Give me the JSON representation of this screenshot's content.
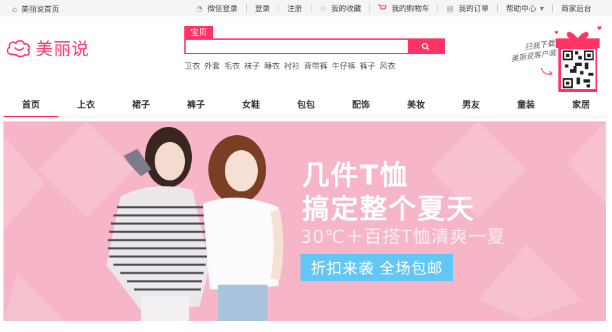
{
  "topbar": {
    "home": "美丽说首页",
    "links": {
      "wechat_login": "微信登录",
      "login": "登录",
      "register": "注册",
      "favorites": "我的收藏",
      "cart": "我的购物车",
      "orders": "我的订单",
      "help": "帮助中心",
      "merchant": "商家后台"
    }
  },
  "logo": {
    "text": "美丽说"
  },
  "search": {
    "tab": "宝贝",
    "value": "",
    "hotwords": [
      "卫衣",
      "外套",
      "毛衣",
      "袜子",
      "睡衣",
      "衬衫",
      "背带裤",
      "牛仔裤",
      "裤子",
      "风衣"
    ]
  },
  "qr": {
    "line1": "扫我下载",
    "line2": "美丽说客户端"
  },
  "nav": [
    "首页",
    "上衣",
    "裙子",
    "裤子",
    "女鞋",
    "包包",
    "配饰",
    "美妆",
    "男友",
    "童装",
    "家居"
  ],
  "banner": {
    "title1": "几件T恤",
    "title2": "搞定整个夏天",
    "subtitle": "30℃＋百搭T恤清爽一夏",
    "button": "折扣来袭 全场包邮"
  },
  "colors": {
    "brand": "#ff3366",
    "banner_bg": "#f6b6c8",
    "banner_button": "#62c7f5"
  }
}
